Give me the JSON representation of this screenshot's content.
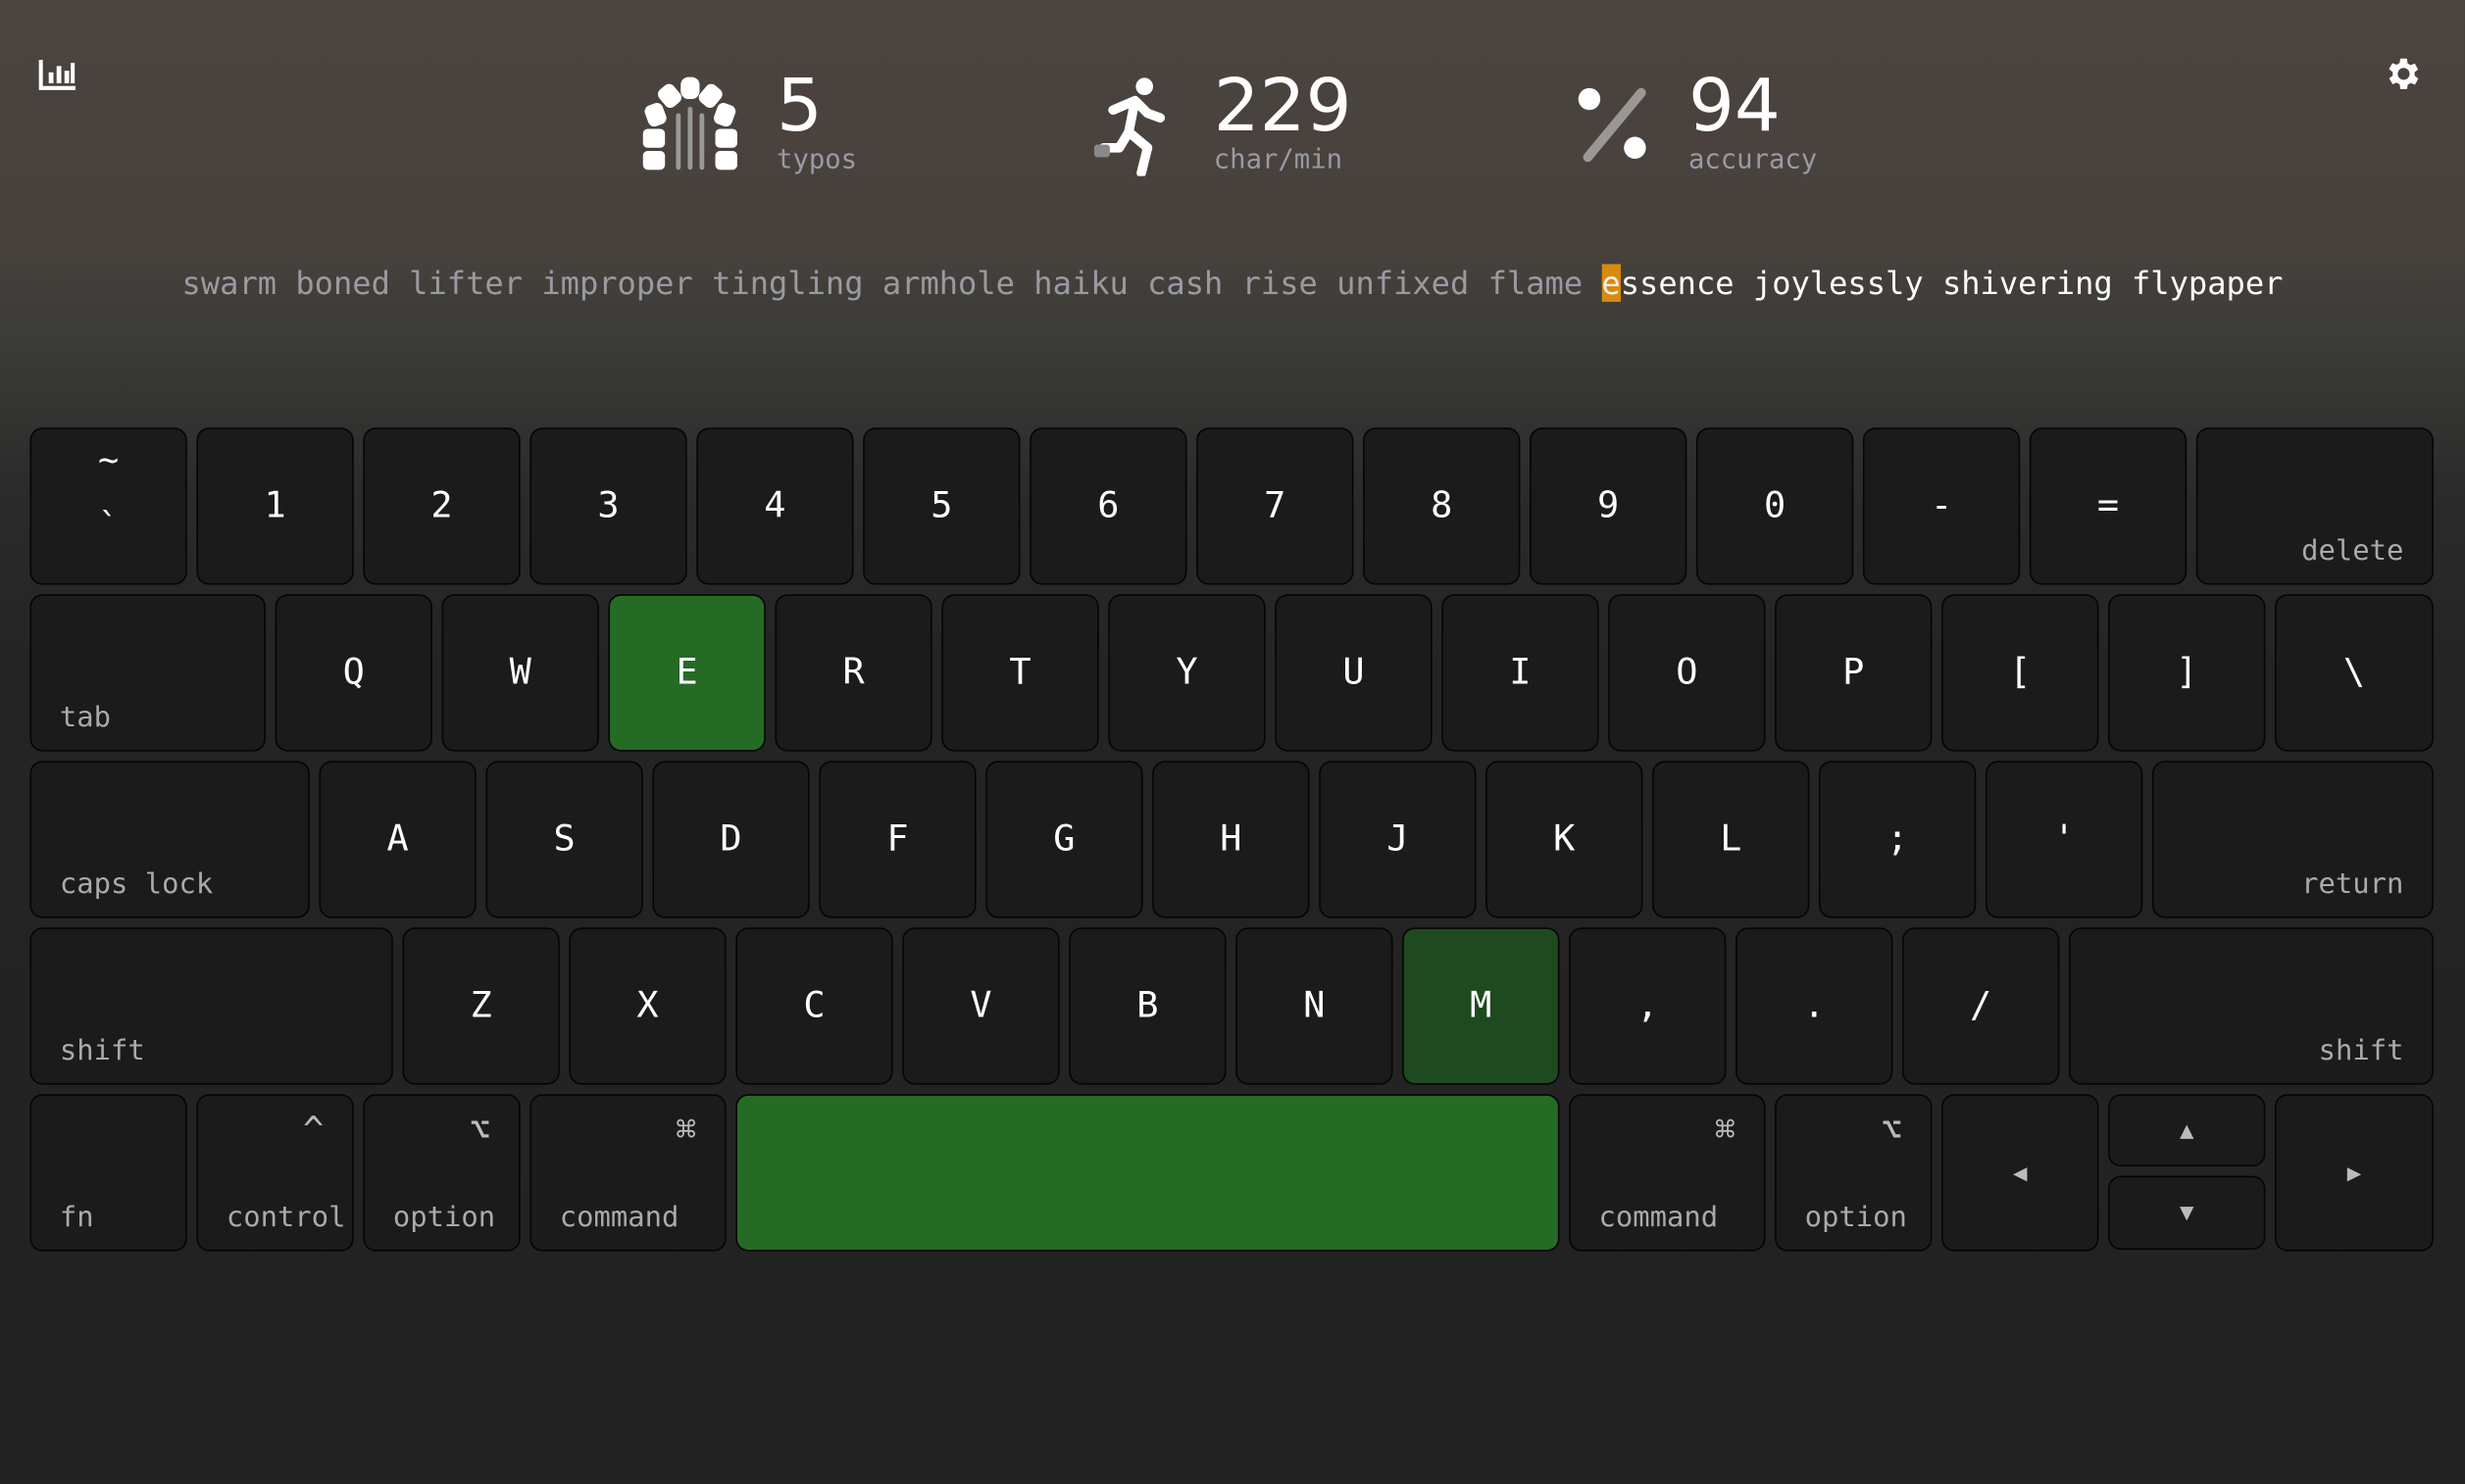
{
  "toolbar": {
    "stats_icon": "bar-chart-icon",
    "settings_icon": "gear-icon"
  },
  "stats": [
    {
      "icon": "arch-icon",
      "value": "5",
      "label": "typos"
    },
    {
      "icon": "running-person-icon",
      "value": "229",
      "label": "char/min"
    },
    {
      "icon": "percent-icon",
      "value": "94",
      "label": "accuracy"
    }
  ],
  "words": {
    "typed": "swarm boned lifter improper tingling armhole haiku cash rise unfixed flame ",
    "cursor_char": "e",
    "remaining": "ssence joylessly shivering flypaper"
  },
  "colors": {
    "cursor": "#d98a0c",
    "pressed": "#256b25",
    "pressed_dim": "#1f4a1f"
  },
  "keyboard": {
    "rows": [
      [
        {
          "top": "~",
          "bottom": "`"
        },
        {
          "c": "1"
        },
        {
          "c": "2"
        },
        {
          "c": "3"
        },
        {
          "c": "4"
        },
        {
          "c": "5"
        },
        {
          "c": "6"
        },
        {
          "c": "7"
        },
        {
          "c": "8"
        },
        {
          "c": "9"
        },
        {
          "c": "0"
        },
        {
          "c": "-"
        },
        {
          "c": "="
        },
        {
          "br": "delete"
        }
      ],
      [
        {
          "bl": "tab"
        },
        {
          "c": "Q"
        },
        {
          "c": "W"
        },
        {
          "c": "E",
          "pressed": true
        },
        {
          "c": "R"
        },
        {
          "c": "T"
        },
        {
          "c": "Y"
        },
        {
          "c": "U"
        },
        {
          "c": "I"
        },
        {
          "c": "O"
        },
        {
          "c": "P"
        },
        {
          "c": "["
        },
        {
          "c": "]"
        },
        {
          "c": "\\"
        }
      ],
      [
        {
          "bl": "caps lock"
        },
        {
          "c": "A"
        },
        {
          "c": "S"
        },
        {
          "c": "D"
        },
        {
          "c": "F"
        },
        {
          "c": "G"
        },
        {
          "c": "H"
        },
        {
          "c": "J"
        },
        {
          "c": "K"
        },
        {
          "c": "L"
        },
        {
          "c": ";"
        },
        {
          "c": "'"
        },
        {
          "br": "return"
        }
      ],
      [
        {
          "bl": "shift"
        },
        {
          "c": "Z"
        },
        {
          "c": "X"
        },
        {
          "c": "C"
        },
        {
          "c": "V"
        },
        {
          "c": "B"
        },
        {
          "c": "N"
        },
        {
          "c": "M",
          "pressed_dim": true
        },
        {
          "c": ","
        },
        {
          "c": "."
        },
        {
          "c": "/"
        },
        {
          "br": "shift"
        }
      ],
      [
        {
          "bl": "fn"
        },
        {
          "bl": "control",
          "tr": "^"
        },
        {
          "bl": "option",
          "tr": "⌥"
        },
        {
          "bl": "command",
          "tr": "⌘"
        },
        {
          "c": "",
          "pressed": true,
          "name": "space"
        },
        {
          "bl": "command",
          "tr": "⌘"
        },
        {
          "bl": "option",
          "tr": "⌥"
        },
        {
          "c": "◀",
          "arrow": "left"
        },
        {
          "c": "▲",
          "arrow": "up"
        },
        {
          "c": "▶",
          "arrow": "right"
        }
      ]
    ],
    "down_arrow": "▼"
  }
}
